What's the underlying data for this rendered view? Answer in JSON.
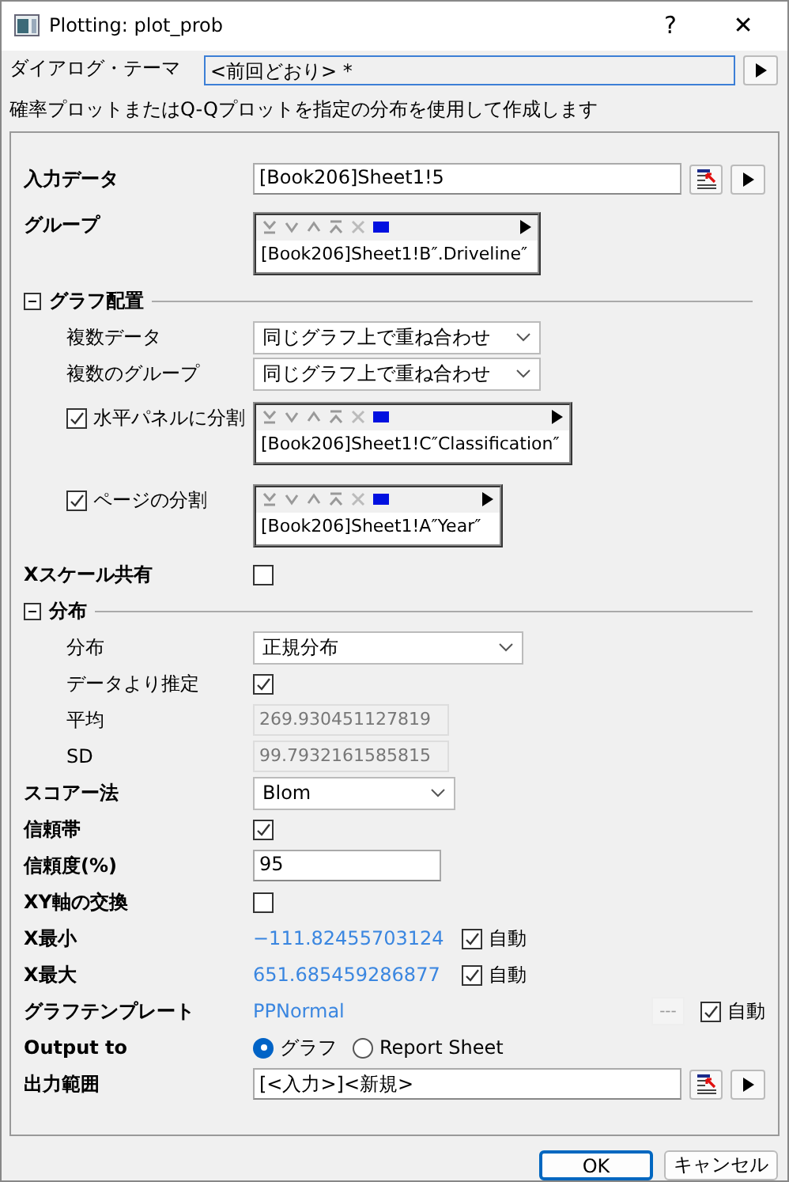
{
  "window": {
    "title": "Plotting: plot_prob",
    "help": "?",
    "close": "✕"
  },
  "theme": {
    "label": "ダイアログ・テーマ",
    "value": "<前回どおり> *"
  },
  "description": "確率プロットまたはQ-Qプロットを指定の分布を使用して作成します",
  "rows": [
    {
      "kind": "range",
      "label": "入力データ",
      "value": "[Book206]Sheet1!5"
    },
    {
      "kind": "list",
      "label": "グループ",
      "items": [
        "[Book206]Sheet1!B″.Driveline″"
      ]
    },
    {
      "kind": "section",
      "label": "グラフ配置",
      "expanded": true,
      "rows": [
        {
          "kind": "dropdown",
          "label": "複数データ",
          "value": "同じグラフ上で重ね合わせ"
        },
        {
          "kind": "dropdown",
          "label": "複数のグループ",
          "value": "同じグラフ上で重ね合わせ"
        },
        {
          "kind": "checklist",
          "label": "水平パネルに分割",
          "checked": true,
          "items": [
            "[Book206]Sheet1!C″Classification″"
          ]
        },
        {
          "kind": "checklist",
          "label": "ページの分割",
          "checked": true,
          "items": [
            "[Book206]Sheet1!A″Year″"
          ]
        }
      ]
    },
    {
      "kind": "checkbox",
      "label": "Xスケール共有",
      "checked": false
    },
    {
      "kind": "section",
      "label": "分布",
      "expanded": true,
      "rows": [
        {
          "kind": "dropdown",
          "label": "分布",
          "value": "正規分布"
        },
        {
          "kind": "checkbox",
          "label": "データより推定",
          "checked": true
        },
        {
          "kind": "readonly",
          "label": "平均",
          "value": "269.930451127819",
          "disabled": true
        },
        {
          "kind": "readonly",
          "label": "SD",
          "value": "99.7932161585815",
          "disabled": true
        }
      ]
    },
    {
      "kind": "dropdown",
      "label": "スコアー法",
      "value": "Blom"
    },
    {
      "kind": "checkbox",
      "label": "信頼帯",
      "checked": true
    },
    {
      "kind": "text",
      "label": "信頼度(%)",
      "value": "95"
    },
    {
      "kind": "checkbox",
      "label": "XY軸の交換",
      "checked": false
    },
    {
      "kind": "auto",
      "label": "X最小",
      "value": "−111.82455703124",
      "auto_label": "自動",
      "checked": true
    },
    {
      "kind": "auto",
      "label": "X最大",
      "value": "651.685459286877",
      "auto_label": "自動",
      "checked": true
    },
    {
      "kind": "template",
      "label": "グラフテンプレート",
      "value": "PPNormal",
      "button": "---",
      "auto_label": "自動",
      "checked": true
    },
    {
      "kind": "radio",
      "label": "Output to",
      "options": [
        {
          "label": "グラフ",
          "selected": true
        },
        {
          "label": "Report Sheet",
          "selected": false
        }
      ]
    },
    {
      "kind": "range",
      "label": "出力範囲",
      "value": "[<入力>]<新規>"
    }
  ],
  "buttons": [
    {
      "label": "OK",
      "default": true
    },
    {
      "label": "キャンセル",
      "default": false
    }
  ]
}
